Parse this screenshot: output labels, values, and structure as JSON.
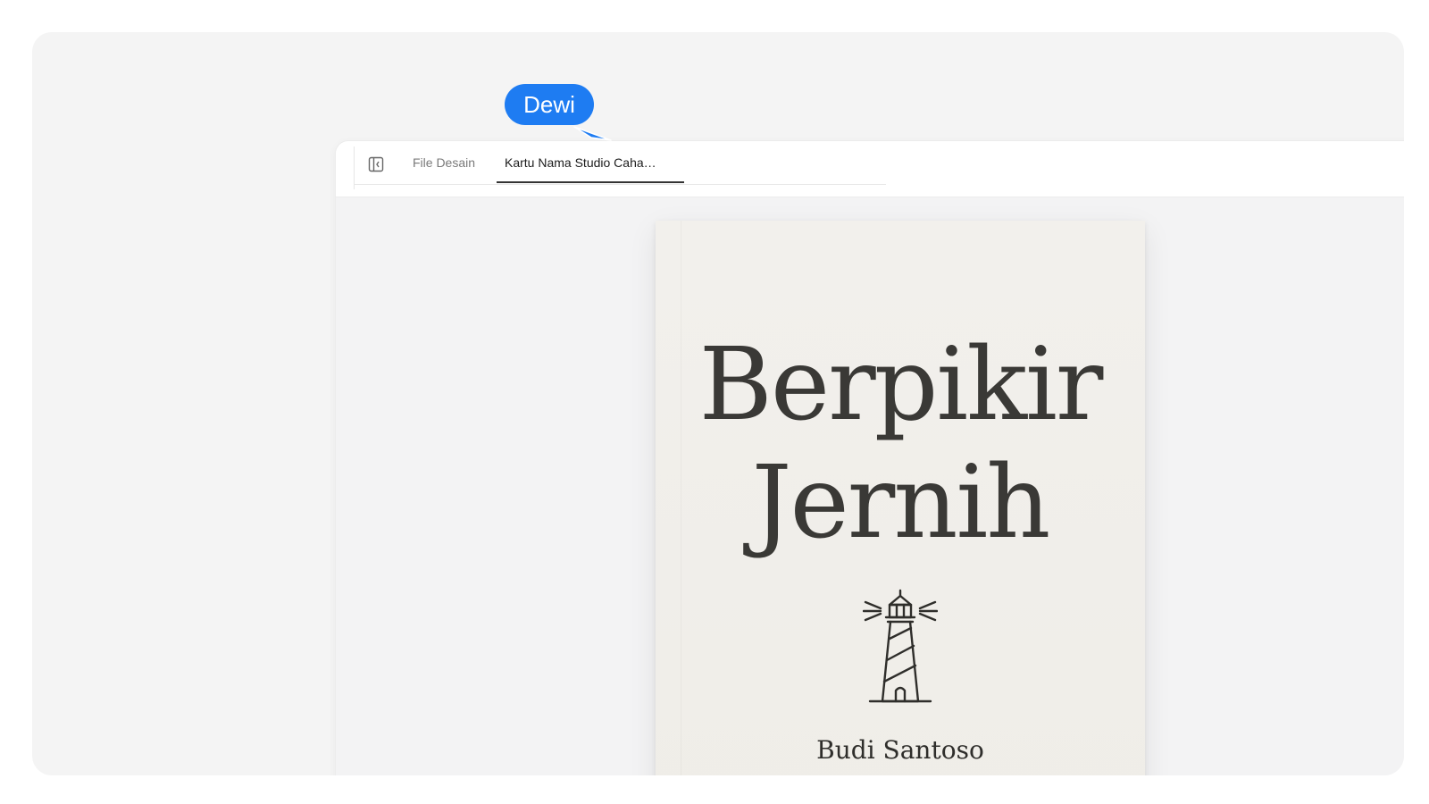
{
  "tabs": {
    "files_label": "File Desain",
    "active_label": "Kartu Nama Studio Caha…"
  },
  "book": {
    "title_line1": "Berpikir",
    "title_line2": "Jernih",
    "author": "Budi Santoso",
    "illustration": "lighthouse-icon"
  },
  "collaborator": {
    "name": "Dewi",
    "color": "#1e7cf2"
  },
  "icons": {
    "sidebar_toggle": "sidebar-toggle-icon"
  }
}
